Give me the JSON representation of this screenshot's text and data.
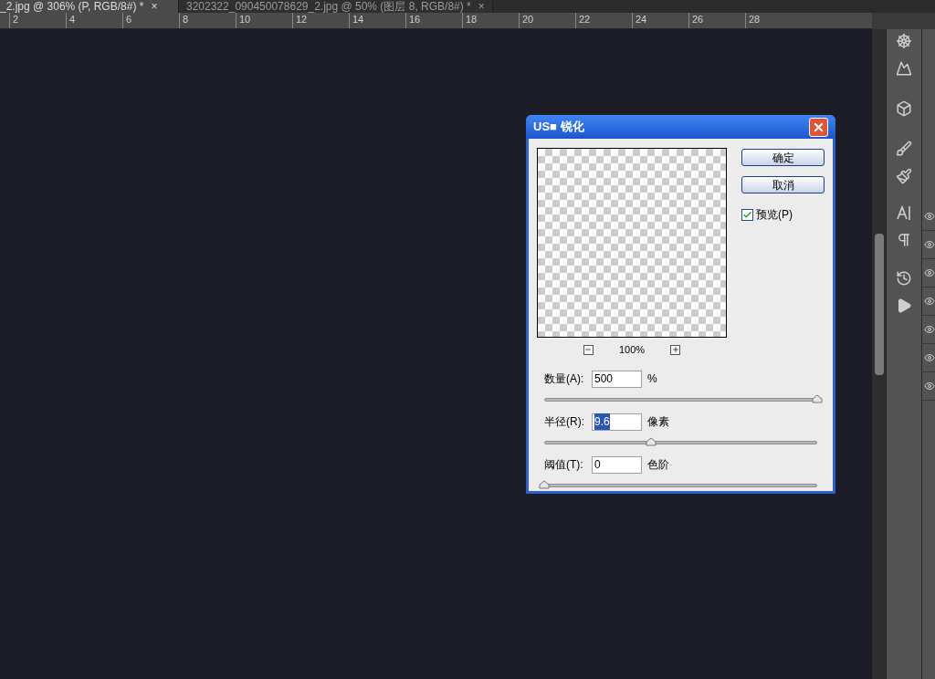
{
  "tabs": [
    {
      "label": "_2.jpg @ 306% (P, RGB/8#) *",
      "close": "×",
      "selected": true
    },
    {
      "label": "3202322_090450078629_2.jpg @ 50% (图层 8, RGB/8#) *",
      "close": "×",
      "selected": false
    }
  ],
  "ruler": {
    "ticks": [
      "2",
      "4",
      "6",
      "8",
      "10",
      "12",
      "14",
      "16",
      "18",
      "20",
      "22",
      "24",
      "26",
      "28"
    ]
  },
  "dialog": {
    "title": "US■ 锐化",
    "zoom": "100%",
    "buttons": [
      "确定",
      "取消"
    ],
    "preview_checkbox": {
      "label": "预览(P)",
      "checked": true
    },
    "params": [
      {
        "label": "数量(A):",
        "value": "500",
        "unit": "%",
        "level": 1,
        "selected": false
      },
      {
        "label": "半径(R):",
        "value": "9.6",
        "unit": "像素",
        "level": 0.39,
        "selected": true
      },
      {
        "label": "阈值(T):",
        "value": "0",
        "unit": "色阶",
        "level": 0,
        "selected": false
      }
    ]
  }
}
